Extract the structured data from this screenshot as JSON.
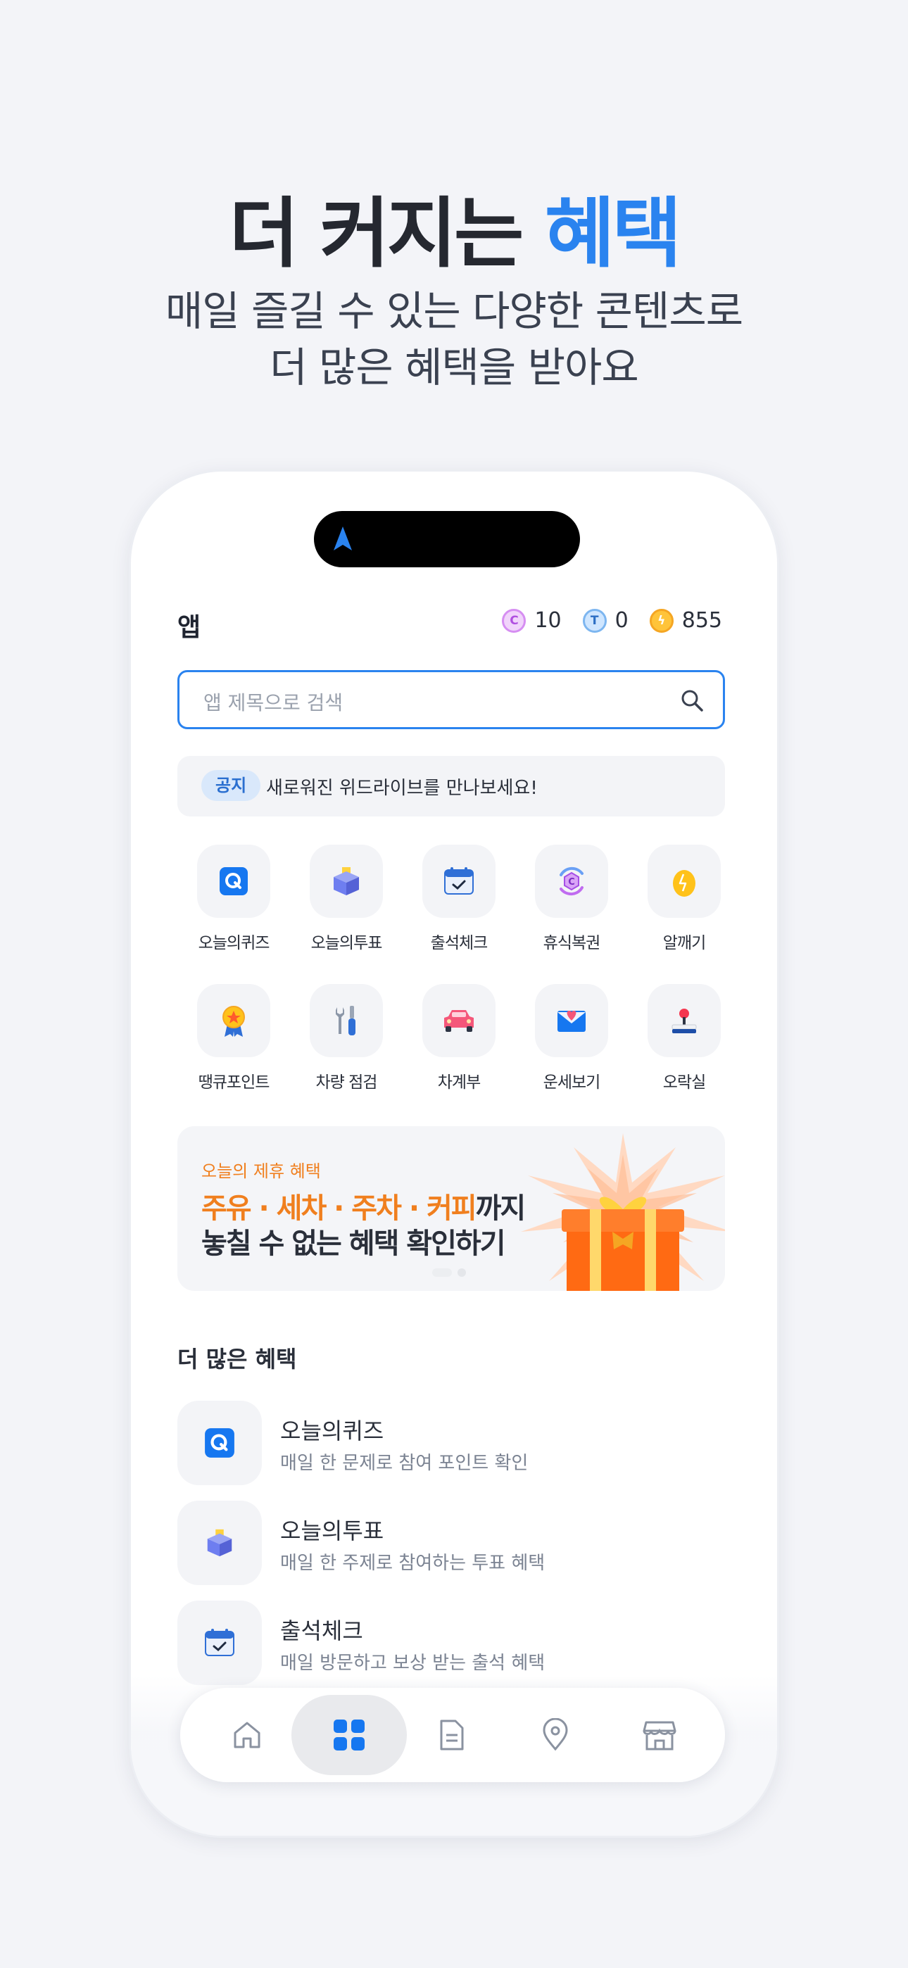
{
  "promo": {
    "title_main": "더 커지는 ",
    "title_accent": "혜택",
    "subtitle_line1": "매일 즐길 수 있는 다양한 콘텐츠로",
    "subtitle_line2": "더 많은 혜택을 받아요"
  },
  "header": {
    "title": "앱",
    "points": [
      {
        "icon": "c-coin-icon",
        "value": "10"
      },
      {
        "icon": "t-coin-icon",
        "value": "0"
      },
      {
        "icon": "bolt-coin-icon",
        "value": "855"
      }
    ]
  },
  "search": {
    "placeholder": "앱 제목으로 검색"
  },
  "notice": {
    "badge": "공지",
    "text": "새로워진 위드라이브를 만나보세요!"
  },
  "grid": [
    {
      "label": "오늘의퀴즈",
      "icon": "quiz-icon"
    },
    {
      "label": "오늘의투표",
      "icon": "ballot-box-icon"
    },
    {
      "label": "출석체크",
      "icon": "calendar-check-icon"
    },
    {
      "label": "휴식복권",
      "icon": "lottery-icon"
    },
    {
      "label": "알깨기",
      "icon": "egg-icon"
    },
    {
      "label": "땡큐포인트",
      "icon": "medal-icon"
    },
    {
      "label": "차량 점검",
      "icon": "tools-icon"
    },
    {
      "label": "차계부",
      "icon": "car-icon"
    },
    {
      "label": "운세보기",
      "icon": "fortune-letter-icon"
    },
    {
      "label": "오락실",
      "icon": "joystick-icon"
    }
  ],
  "banner": {
    "kicker": "오늘의 제휴 혜택",
    "line1_accent": "주유 · 세차 · 주차 · 커피",
    "line1_rest": "까지",
    "line2": "놓칠 수 없는 혜택 확인하기"
  },
  "more": {
    "title": "더 많은 혜택",
    "items": [
      {
        "title": "오늘의퀴즈",
        "desc": "매일 한 문제로 참여 포인트 확인",
        "icon": "quiz-icon"
      },
      {
        "title": "오늘의투표",
        "desc": "매일 한 주제로 참여하는 투표 혜택",
        "icon": "ballot-box-icon"
      },
      {
        "title": "출석체크",
        "desc": "매일 방문하고 보상 받는 출석 혜택",
        "icon": "calendar-check-icon"
      }
    ]
  },
  "tabbar": [
    "home-icon",
    "apps-grid-icon",
    "document-icon",
    "location-pin-icon",
    "store-icon"
  ],
  "colors": {
    "accent": "#2a83ef",
    "orange": "#f07f1e",
    "background": "#f3f4f8"
  }
}
